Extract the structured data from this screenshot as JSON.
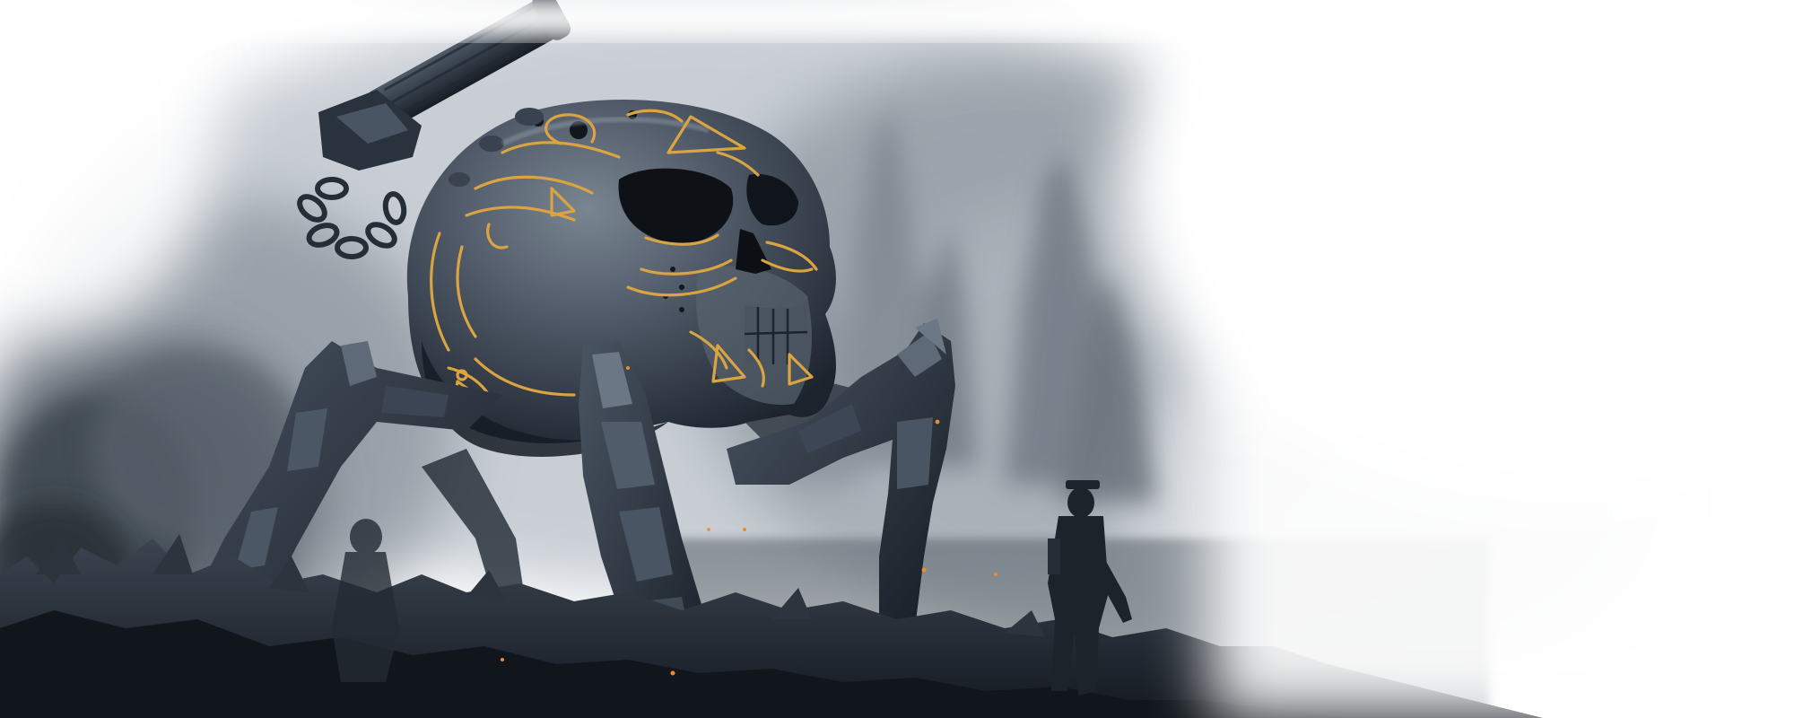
{
  "image": {
    "subject": "illustration",
    "palette": {
      "background": "#ffffff",
      "fog_light": "#e9ecef",
      "fog_mid": "#b9c0c8",
      "fog_dark": "#6d7680",
      "metal_dark": "#1f2630",
      "metal_mid": "#3a4452",
      "metal_light": "#6a7684",
      "gold": "#d9a441",
      "ember": "#f08a2a"
    },
    "icons": [
      "skull-head",
      "spider-legs",
      "cannon",
      "soldier-silhouette",
      "rock-spires",
      "fog"
    ]
  }
}
